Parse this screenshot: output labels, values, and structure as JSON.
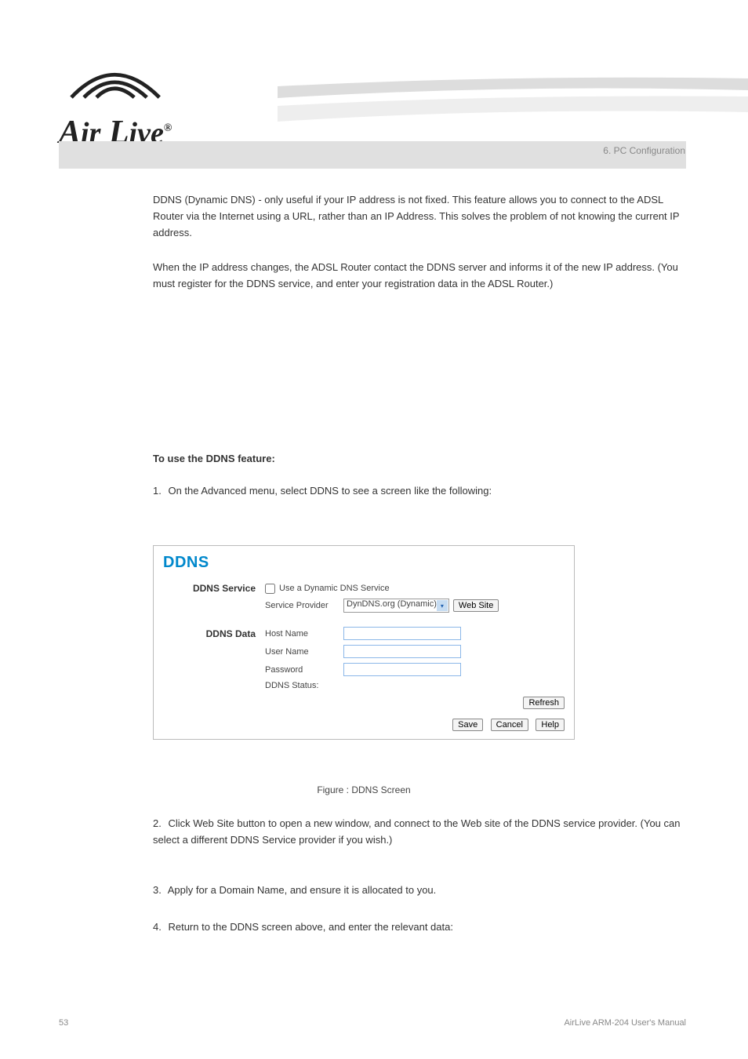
{
  "chapter": "6. PC Configuration",
  "paragraphs": {
    "p1": "DDNS (Dynamic DNS) - only useful if your IP address is not fixed. This feature allows you to connect to the ADSL Router via the Internet using a URL, rather than an IP Address. This solves the problem of not knowing the current IP address.",
    "p2": "When the IP address changes, the ADSL Router contact the DDNS server and informs it of the new IP address. (You must register for the DDNS service, and enter your registration data in the ADSL Router.)"
  },
  "section_title": "To use the DDNS feature:",
  "steps": {
    "s1_num": "1.",
    "s1_text": "On the Advanced menu, select DDNS to see a screen like the following:",
    "s2_num": "2.",
    "s2_text": "Click Web Site button to open a new window, and connect to the Web site of the DDNS service provider. (You can select a different DDNS Service provider if you wish.)",
    "s3_num": "3.",
    "s3_text": "Apply for a Domain Name, and ensure it is allocated to you.",
    "s4_num": "4.",
    "s4_text": "Return to the DDNS screen above, and enter the relevant data:"
  },
  "panel": {
    "title": "DDNS",
    "service_label": "DDNS Service",
    "use_ddns_label": "Use a Dynamic DNS Service",
    "service_provider_label": "Service Provider",
    "service_provider_value": "DynDNS.org (Dynamic)",
    "website_button": "Web Site",
    "data_label": "DDNS Data",
    "host_name_label": "Host Name",
    "user_name_label": "User Name",
    "password_label": "Password",
    "status_label": "DDNS Status:",
    "refresh_button": "Refresh",
    "save_button": "Save",
    "cancel_button": "Cancel",
    "help_button": "Help"
  },
  "figure_caption": "Figure : DDNS Screen",
  "footer": {
    "page": "53",
    "product": "AirLive ARM-204 User's Manual"
  }
}
